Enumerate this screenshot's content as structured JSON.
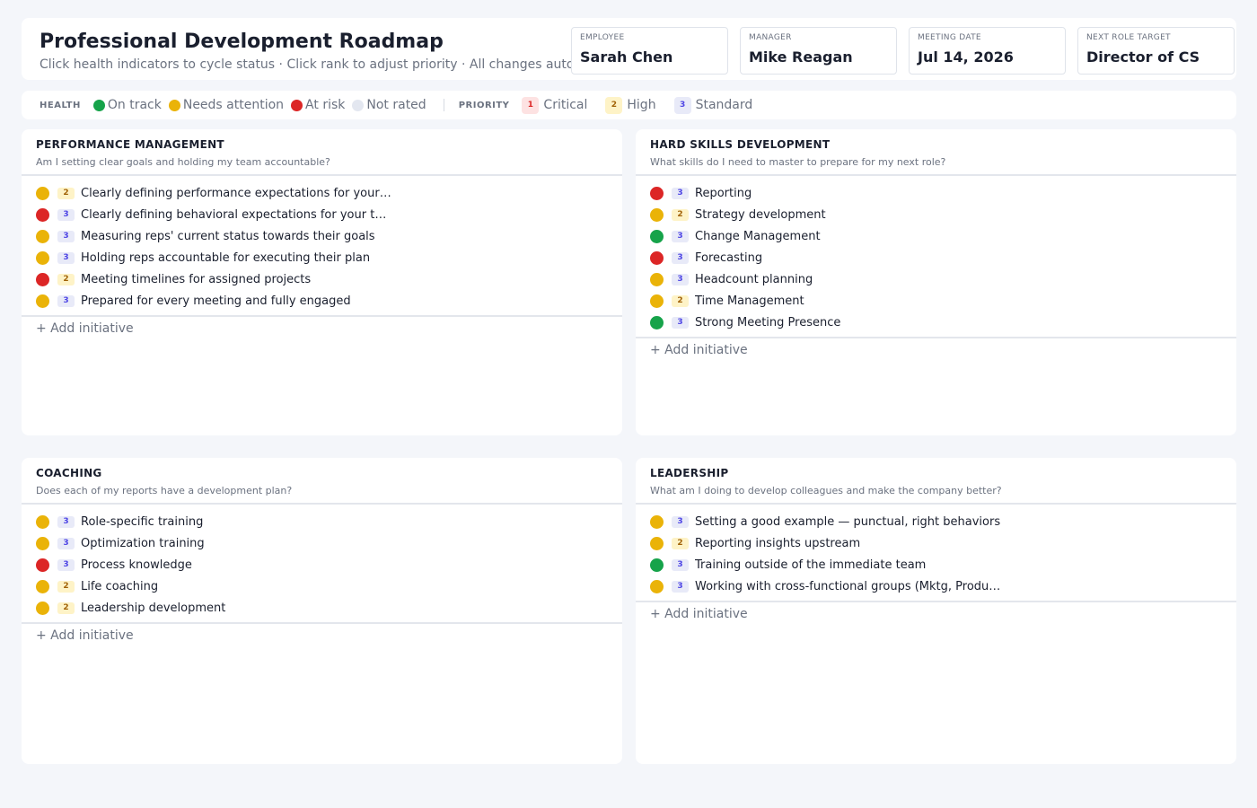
{
  "header": {
    "title": "Professional Development Roadmap",
    "subtitle": "Click health indicators to cycle status · Click rank to adjust priority · All changes auto-save",
    "meta": [
      {
        "label": "EMPLOYEE",
        "value": "Sarah Chen"
      },
      {
        "label": "MANAGER",
        "value": "Mike Reagan"
      },
      {
        "label": "MEETING DATE",
        "value": "Jul 14, 2026"
      },
      {
        "label": "NEXT ROLE TARGET",
        "value": "Director of CS"
      }
    ]
  },
  "legend": {
    "health_heading": "HEALTH",
    "health": [
      {
        "label": "On track",
        "color": "#16a34a"
      },
      {
        "label": "Needs attention",
        "color": "#eab308"
      },
      {
        "label": "At risk",
        "color": "#dc2626"
      },
      {
        "label": "Not rated",
        "color": "#e3e7f0"
      }
    ],
    "priority_heading": "PRIORITY",
    "priority": [
      {
        "rank": "1",
        "label": "Critical"
      },
      {
        "rank": "2",
        "label": "High"
      },
      {
        "rank": "3",
        "label": "Standard"
      }
    ]
  },
  "add_label": "+ Add initiative",
  "panels": [
    {
      "title": "PERFORMANCE MANAGEMENT",
      "question": "Am I setting clear goals and holding my team accountable?",
      "items": [
        {
          "status": "yellow",
          "rank": "2",
          "label": "Clearly defining performance expectations for your team"
        },
        {
          "status": "red",
          "rank": "3",
          "label": "Clearly defining behavioral expectations for your team"
        },
        {
          "status": "yellow",
          "rank": "3",
          "label": "Measuring reps' current status towards their goals"
        },
        {
          "status": "yellow",
          "rank": "3",
          "label": "Holding reps accountable for executing their plan"
        },
        {
          "status": "red",
          "rank": "2",
          "label": "Meeting timelines for assigned projects"
        },
        {
          "status": "yellow",
          "rank": "3",
          "label": "Prepared for every meeting and fully engaged"
        }
      ]
    },
    {
      "title": "HARD SKILLS DEVELOPMENT",
      "question": "What skills do I need to master to prepare for my next role?",
      "items": [
        {
          "status": "red",
          "rank": "3",
          "label": "Reporting"
        },
        {
          "status": "yellow",
          "rank": "2",
          "label": "Strategy development"
        },
        {
          "status": "green",
          "rank": "3",
          "label": "Change Management"
        },
        {
          "status": "red",
          "rank": "3",
          "label": "Forecasting"
        },
        {
          "status": "yellow",
          "rank": "3",
          "label": "Headcount planning"
        },
        {
          "status": "yellow",
          "rank": "2",
          "label": "Time Management"
        },
        {
          "status": "green",
          "rank": "3",
          "label": "Strong Meeting Presence"
        }
      ]
    },
    {
      "title": "COACHING",
      "question": "Does each of my reports have a development plan?",
      "items": [
        {
          "status": "yellow",
          "rank": "3",
          "label": "Role-specific training"
        },
        {
          "status": "yellow",
          "rank": "3",
          "label": "Optimization training"
        },
        {
          "status": "red",
          "rank": "3",
          "label": "Process knowledge"
        },
        {
          "status": "yellow",
          "rank": "2",
          "label": "Life coaching"
        },
        {
          "status": "yellow",
          "rank": "2",
          "label": "Leadership development"
        }
      ]
    },
    {
      "title": "LEADERSHIP",
      "question": "What am I doing to develop colleagues and make the company better?",
      "items": [
        {
          "status": "yellow",
          "rank": "3",
          "label": "Setting a good example — punctual, right behaviors"
        },
        {
          "status": "yellow",
          "rank": "2",
          "label": "Reporting insights upstream"
        },
        {
          "status": "green",
          "rank": "3",
          "label": "Training outside of the immediate team"
        },
        {
          "status": "yellow",
          "rank": "3",
          "label": "Working with cross-functional groups (Mktg, Product, Sales)"
        }
      ]
    }
  ]
}
